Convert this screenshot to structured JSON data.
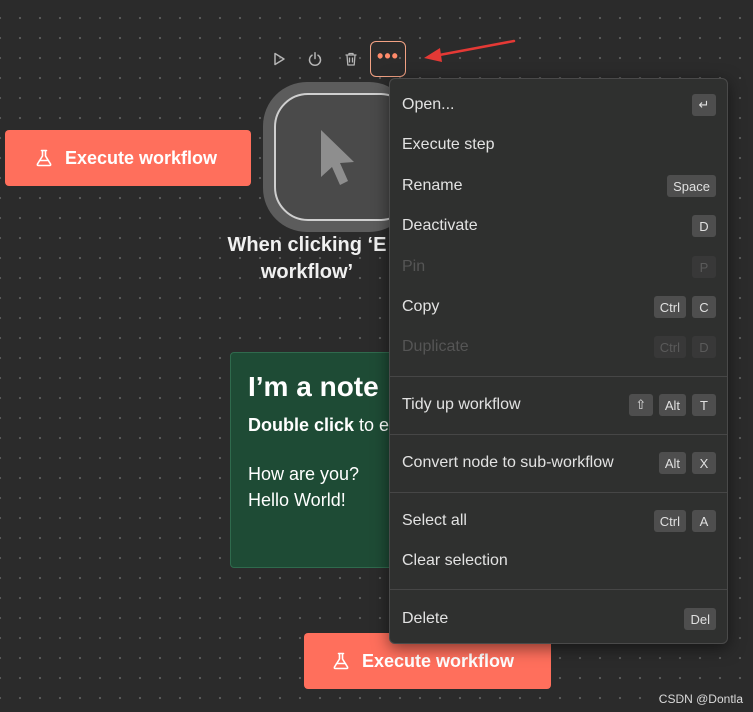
{
  "toolbar": {
    "buttons": [
      {
        "icon": "play-icon"
      },
      {
        "icon": "power-icon"
      },
      {
        "icon": "trash-icon"
      },
      {
        "icon": "more-icon",
        "glyph": "•••"
      }
    ]
  },
  "execute_button": {
    "label": "Execute workflow",
    "icon": "flask-icon"
  },
  "trigger_node": {
    "label": "When clicking ‘E\nworkflow’",
    "icon": "cursor-icon"
  },
  "sticky_note": {
    "title": "I’m a note",
    "line1_bold": "Double click",
    "line1_rest": " to e",
    "line2": "How are you?",
    "line3": "Hello World!"
  },
  "context_menu": {
    "items": [
      {
        "label": "Open...",
        "keys": [
          "↵"
        ],
        "disabled": false
      },
      {
        "label": "Execute step",
        "keys": [],
        "disabled": false
      },
      {
        "label": "Rename",
        "keys": [
          "Space"
        ],
        "disabled": false
      },
      {
        "label": "Deactivate",
        "keys": [
          "D"
        ],
        "disabled": false
      },
      {
        "label": "Pin",
        "keys": [
          "P"
        ],
        "disabled": true
      },
      {
        "label": "Copy",
        "keys": [
          "Ctrl",
          "C"
        ],
        "disabled": false
      },
      {
        "label": "Duplicate",
        "keys": [
          "Ctrl",
          "D"
        ],
        "disabled": true
      },
      {
        "label": "Tidy up workflow",
        "keys": [
          "⇧",
          "Alt",
          "T"
        ],
        "disabled": false
      },
      {
        "label": "Convert node to sub-workflow",
        "keys": [
          "Alt",
          "X"
        ],
        "disabled": false
      },
      {
        "label": "Select all",
        "keys": [
          "Ctrl",
          "A"
        ],
        "disabled": false
      },
      {
        "label": "Clear selection",
        "keys": [],
        "disabled": false
      },
      {
        "label": "Delete",
        "keys": [
          "Del"
        ],
        "disabled": false
      }
    ]
  },
  "watermark": "CSDN @Dontla",
  "colors": {
    "canvas": "#2b2b2b",
    "accent": "#ff6f5c",
    "note_bg": "#1e4b35",
    "menu_bg": "#2f302f",
    "arrow": "#e53935"
  }
}
